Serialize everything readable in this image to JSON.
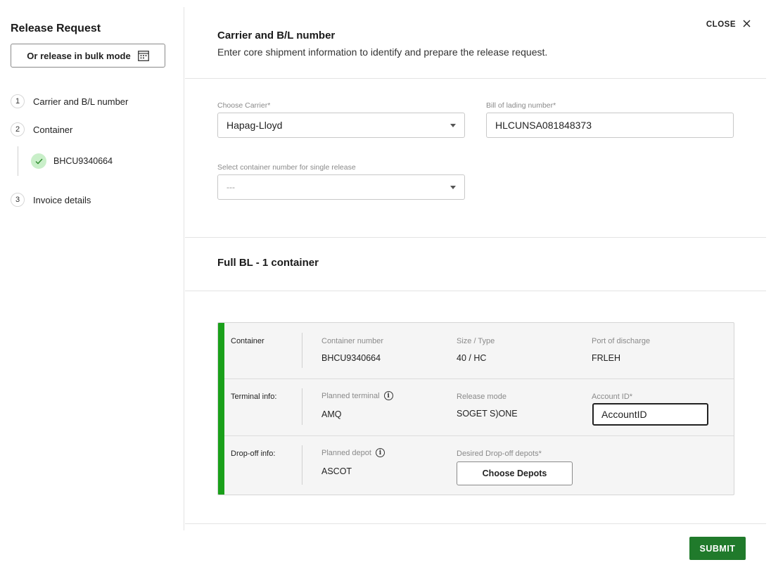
{
  "sidebar": {
    "title": "Release Request",
    "bulk_button_label": "Or release in bulk mode",
    "steps": [
      {
        "number": "1",
        "label": "Carrier and B/L number"
      },
      {
        "number": "2",
        "label": "Container"
      },
      {
        "number": "3",
        "label": "Invoice details"
      }
    ],
    "container_substep": {
      "label": "BHCU9340664",
      "status": "complete"
    }
  },
  "header": {
    "title": "Carrier and B/L number",
    "subtitle": "Enter core shipment information to identify and prepare the release request.",
    "close_label": "CLOSE"
  },
  "form": {
    "carrier": {
      "label": "Choose Carrier*",
      "value": "Hapag-Lloyd"
    },
    "bl_number": {
      "label": "Bill of lading number*",
      "value": "HLCUNSA081848373"
    },
    "container_select": {
      "label": "Select container number for single release",
      "value": "---"
    }
  },
  "full_bl": {
    "title": "Full BL - 1 container"
  },
  "container_card": {
    "container_row": {
      "label": "Container",
      "container_number_label": "Container number",
      "container_number": "BHCU9340664",
      "size_type_label": "Size / Type",
      "size_type": "40 / HC",
      "port_label": "Port of discharge",
      "port": "FRLEH"
    },
    "terminal_row": {
      "label": "Terminal info:",
      "planned_terminal_label": "Planned terminal",
      "planned_terminal": "AMQ",
      "release_mode_label": "Release mode",
      "release_mode": "SOGET S)ONE",
      "account_id_label": "Account ID*",
      "account_id_value": "AccountID"
    },
    "dropoff_row": {
      "label": "Drop-off info:",
      "planned_depot_label": "Planned depot",
      "planned_depot": "ASCOT",
      "desired_depots_label": "Desired Drop-off depots*",
      "choose_depots_label": "Choose Depots"
    },
    "accent_color": "#1aa01a"
  },
  "footer": {
    "submit_label": "SUBMIT",
    "submit_color": "#207a2b"
  },
  "icons": {
    "bulk": "calendar-grid-icon",
    "close": "close-icon",
    "check": "check-icon",
    "info": "info-icon",
    "caret": "chevron-down-icon"
  }
}
